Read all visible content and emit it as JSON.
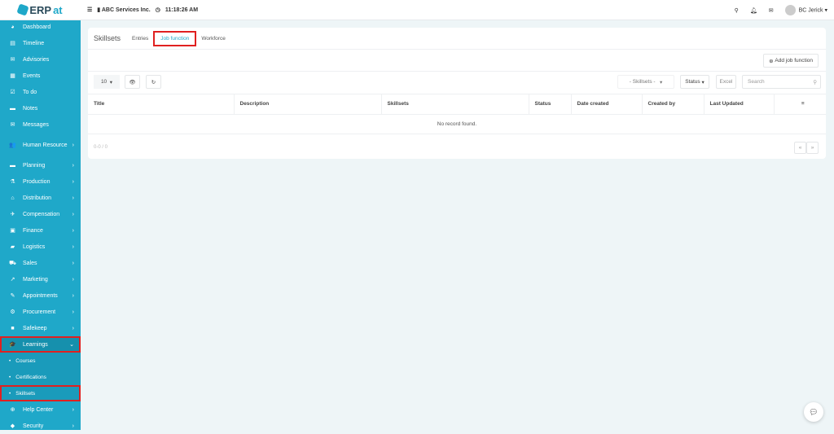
{
  "header": {
    "logo_prefix": "ERP",
    "logo_suffix": "at",
    "company": "ABC Services Inc.",
    "time": "11:18:26 AM",
    "user": "BC Jerick"
  },
  "sidebar": {
    "items": [
      {
        "label": "Dashboard",
        "icon": "◕"
      },
      {
        "label": "Timeline",
        "icon": "▤"
      },
      {
        "label": "Advisories",
        "icon": "✉"
      },
      {
        "label": "Events",
        "icon": "▦"
      },
      {
        "label": "To do",
        "icon": "☑"
      },
      {
        "label": "Notes",
        "icon": "▬"
      },
      {
        "label": "Messages",
        "icon": "✉"
      },
      {
        "label": "Human Resource",
        "icon": "👥",
        "chev": "›"
      },
      {
        "label": "Planning",
        "icon": "▬",
        "chev": "›"
      },
      {
        "label": "Production",
        "icon": "⚗",
        "chev": "›"
      },
      {
        "label": "Distribution",
        "icon": "⌂",
        "chev": "›"
      },
      {
        "label": "Compensation",
        "icon": "✈",
        "chev": "›"
      },
      {
        "label": "Finance",
        "icon": "▣",
        "chev": "›"
      },
      {
        "label": "Logistics",
        "icon": "▰",
        "chev": "›"
      },
      {
        "label": "Sales",
        "icon": "⛟",
        "chev": "›"
      },
      {
        "label": "Marketing",
        "icon": "↗",
        "chev": "›"
      },
      {
        "label": "Appointments",
        "icon": "✎",
        "chev": "›"
      },
      {
        "label": "Procurement",
        "icon": "⚙",
        "chev": "›"
      },
      {
        "label": "Safekeep",
        "icon": "■",
        "chev": "›"
      }
    ],
    "learnings": {
      "label": "Learnings",
      "icon": "🎓",
      "chev": "⌄"
    },
    "sub": [
      {
        "label": "Courses"
      },
      {
        "label": "Certifications"
      },
      {
        "label": "Skillsets"
      }
    ],
    "after": [
      {
        "label": "Help Center",
        "icon": "⊕",
        "chev": "›"
      },
      {
        "label": "Security",
        "icon": "◆",
        "chev": "›"
      }
    ]
  },
  "main": {
    "title": "Skillsets",
    "tabs": [
      "Entries",
      "Job function",
      "Workforce"
    ],
    "add_button": "Add job function",
    "page_size": "10",
    "skillsets_filter": "- Skillsets -",
    "status_filter": "Status",
    "excel": "Excel",
    "search_placeholder": "Search",
    "columns": [
      "Title",
      "Description",
      "Skillsets",
      "Status",
      "Date created",
      "Created by",
      "Last Updated",
      "≡"
    ],
    "empty": "No record found.",
    "count": "0-0 / 0",
    "prev": "«",
    "next": "»"
  }
}
